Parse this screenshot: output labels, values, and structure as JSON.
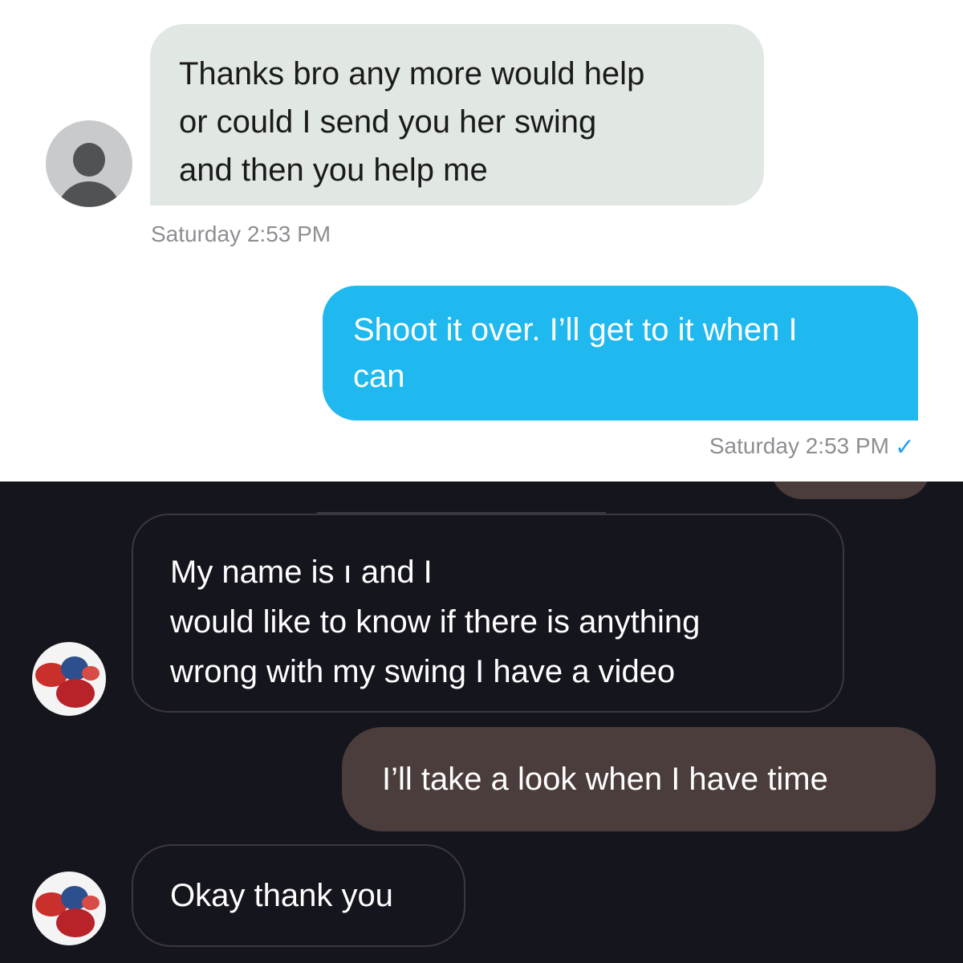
{
  "top_conversation": {
    "messages": [
      {
        "direction": "incoming",
        "text": "Thanks bro any more would help\nor could I send you her swing\nand then you help me",
        "timestamp": "Saturday 2:53 PM"
      },
      {
        "direction": "outgoing",
        "text": "Shoot it over. I’ll get to it when I\ncan",
        "timestamp": "Saturday 2:53 PM",
        "status_icon": "checkmark-icon"
      }
    ],
    "colors": {
      "incoming_bubble": "#e1e7e2",
      "outgoing_bubble": "#1fb8ef",
      "check": "#2aa3e8"
    }
  },
  "bottom_conversation": {
    "messages": [
      {
        "direction": "incoming",
        "text": "My name is                               ı and I\nwould like to know if there is anything\nwrong with my swing I have a video"
      },
      {
        "direction": "outgoing",
        "text": "I’ll take a look when I have time"
      },
      {
        "direction": "incoming",
        "text": "Okay thank you"
      }
    ],
    "colors": {
      "background": "#15151e",
      "outgoing_bubble": "#4a3d3b",
      "incoming_border": "#3b3740"
    }
  }
}
